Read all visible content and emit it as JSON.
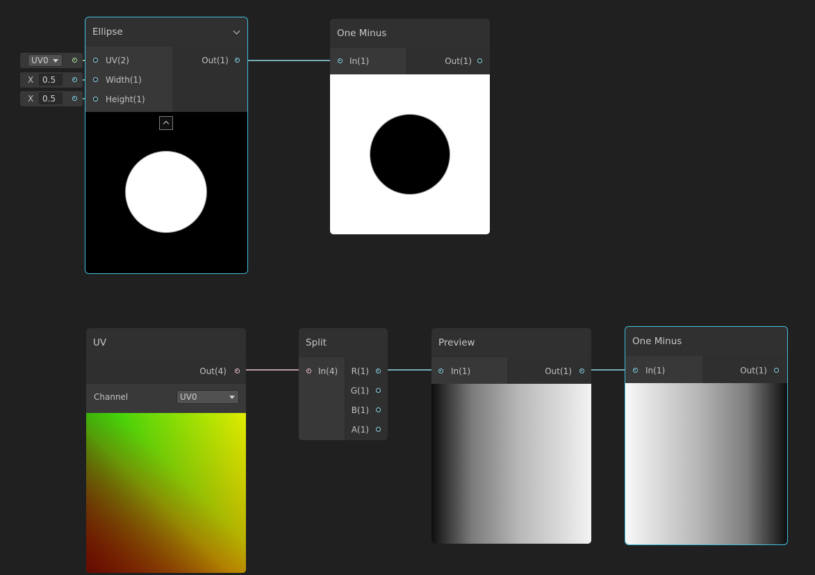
{
  "nodes": {
    "ellipse": {
      "title": "Ellipse",
      "inputs": [
        "UV(2)",
        "Width(1)",
        "Height(1)"
      ],
      "output": "Out(1)"
    },
    "one_minus_top": {
      "title": "One Minus",
      "input": "In(1)",
      "output": "Out(1)"
    },
    "uv": {
      "title": "UV",
      "output": "Out(4)",
      "channel_label": "Channel",
      "channel_value": "UV0"
    },
    "split": {
      "title": "Split",
      "input": "In(4)",
      "outputs": [
        "R(1)",
        "G(1)",
        "B(1)",
        "A(1)"
      ]
    },
    "preview": {
      "title": "Preview",
      "input": "In(1)",
      "output": "Out(1)"
    },
    "one_minus_bottom": {
      "title": "One Minus",
      "input": "In(1)",
      "output": "Out(1)"
    }
  },
  "inline_inputs": {
    "uv_dropdown": "UV0",
    "width_axis": "X",
    "width_value": "0.5",
    "height_axis": "X",
    "height_value": "0.5"
  },
  "colors": {
    "canvas": "#202020",
    "node_body": "#393939",
    "node_header": "#303030",
    "wire_float": "#8fd9e9",
    "wire_vector4": "#f0c6d6",
    "wire_vector2": "#b6e8a5",
    "selection": "#44c0e0"
  }
}
